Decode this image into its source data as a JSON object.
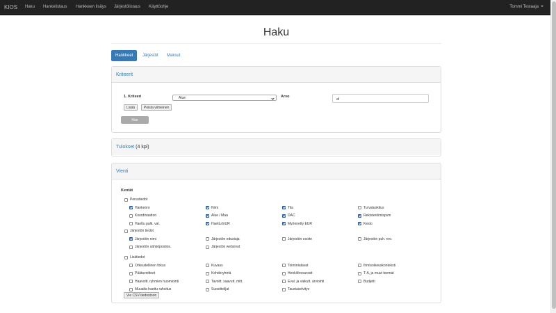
{
  "navbar": {
    "brand": "KIOS",
    "items": [
      "Haku",
      "Hankelistaus",
      "Hankkeen lisäys",
      "Järjestölistaus",
      "Käyttöohje"
    ],
    "user": "Tommi Testaaja"
  },
  "page": {
    "title": "Haku"
  },
  "tabs": [
    {
      "label": "Hankkeet",
      "active": true
    },
    {
      "label": "Järjestöt",
      "active": false
    },
    {
      "label": "Maksut",
      "active": false
    }
  ],
  "criteria": {
    "heading": "Kriteerit",
    "criterion_label": "1. Kriteeri",
    "field_selected": "Alue",
    "value_label": "Arvo",
    "value": "af",
    "add_button": "Lisää",
    "remove_button": "Poista viimeinen",
    "search_button": "Hae"
  },
  "results": {
    "heading": "Tulokset",
    "count": "(4 kpl)"
  },
  "export": {
    "heading": "Vienti",
    "fields_label": "Kentät",
    "groups": [
      {
        "label": "Perustiedot",
        "checked": false,
        "items": [
          {
            "label": "Hankenro",
            "checked": true
          },
          {
            "label": "Nimi",
            "checked": true
          },
          {
            "label": "Tila",
            "checked": true
          },
          {
            "label": "Turvaluokitus",
            "checked": false
          },
          {
            "label": "Koordinaattori",
            "checked": false
          },
          {
            "label": "Alue / Maa",
            "checked": true
          },
          {
            "label": "DAC",
            "checked": true
          },
          {
            "label": "Rekisteröimispvm",
            "checked": true
          },
          {
            "label": "Haettu palk. val.",
            "checked": false
          },
          {
            "label": "Haettu EUR",
            "checked": true
          },
          {
            "label": "Myönnetty EUR",
            "checked": true
          },
          {
            "label": "Kesto",
            "checked": true
          }
        ]
      },
      {
        "label": "Järjestön tiedot",
        "checked": false,
        "items": [
          {
            "label": "Järjestön nimi",
            "checked": true
          },
          {
            "label": "Järjestön edustaja",
            "checked": false
          },
          {
            "label": "Järjestön osoite",
            "checked": false
          },
          {
            "label": "Järjestön puh. nro.",
            "checked": false
          },
          {
            "label": "Järjestön sähköpostios.",
            "checked": false
          },
          {
            "label": "Järjestön websivut",
            "checked": false
          }
        ]
      },
      {
        "label": "Lisätiedot",
        "checked": false,
        "items": [
          {
            "label": "Orkeudellinen fokus",
            "checked": false
          },
          {
            "label": "Kuvaus",
            "checked": false
          },
          {
            "label": "Toimintatavat",
            "checked": false
          },
          {
            "label": "Ihmisoikeuskonteksti",
            "checked": false
          },
          {
            "label": "Päätavoitteet",
            "checked": false
          },
          {
            "label": "Kohderyhmä",
            "checked": false
          },
          {
            "label": "Henkilöresurssit",
            "checked": false
          },
          {
            "label": "T-A, ja muut teemat",
            "checked": false
          },
          {
            "label": "Haavoitt. ryhmien huomiointi",
            "checked": false
          },
          {
            "label": "Tavoitt. saavutt. mitt.",
            "checked": false
          },
          {
            "label": "Eval. ja vaikutt. arviointi",
            "checked": false
          },
          {
            "label": "Budjetti",
            "checked": false
          },
          {
            "label": "Muualta haettu rahoitus",
            "checked": false
          },
          {
            "label": "Suosittelijat",
            "checked": false
          },
          {
            "label": "Taustaselvitys",
            "checked": false
          }
        ]
      }
    ],
    "export_button": "Vie CSV-tiedostoon"
  }
}
